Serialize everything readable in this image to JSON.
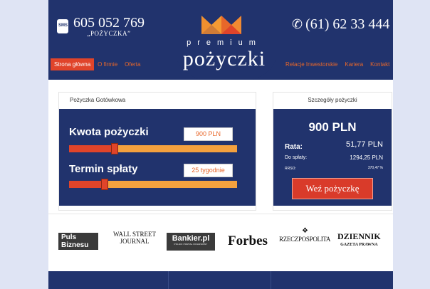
{
  "header": {
    "sms_phone": "605 052 769",
    "sms_phone_sub": "„POŻYCZKA”",
    "sms_icon_text": "SMS",
    "phone": "(61) 62 33 444",
    "brand_top": "premium",
    "brand_main": "pożyczki"
  },
  "nav": {
    "left": [
      "Strona główna",
      "O firmie",
      "Oferta"
    ],
    "right": [
      "Relacje Inwestorskie",
      "Kariera",
      "Kontakt"
    ]
  },
  "loan": {
    "title": "Pożyczka Gotówkowa",
    "amount_label": "Kwota pożyczki",
    "amount_value": "900 PLN",
    "amount_fraction": 0.27,
    "term_label": "Termin spłaty",
    "term_value": "25 tygodnie",
    "term_fraction": 0.21
  },
  "details": {
    "title": "Szczegóły pożyczki",
    "amount": "900 PLN",
    "rate_label": "Rata:",
    "rate_value": "51,77 PLN",
    "repay_label": "Do spłaty:",
    "repay_value": "1294,25 PLN",
    "rrso_label": "RRSO:",
    "rrso_value": "370,47 %",
    "apply_button": "Weź pożyczkę"
  },
  "press_logos": {
    "puls_line1": "Puls",
    "puls_line2": "Biznesu",
    "wsj_line1": "WALL STREET",
    "wsj_line2": "JOURNAL",
    "bankier": "Bankier.pl",
    "bankier_tag": "POLSKI PORTAL FINANSOWY",
    "forbes": "Forbes",
    "rzeczpospolita": "RZECZPOSPOLITA",
    "dziennik_line1": "DZIENNIK",
    "dziennik_line2": "GAZETA PRAWNA"
  },
  "colors": {
    "navy": "#21336d",
    "orange": "#e8672a",
    "red": "#e0442a",
    "slider_track": "#f4a13e"
  }
}
